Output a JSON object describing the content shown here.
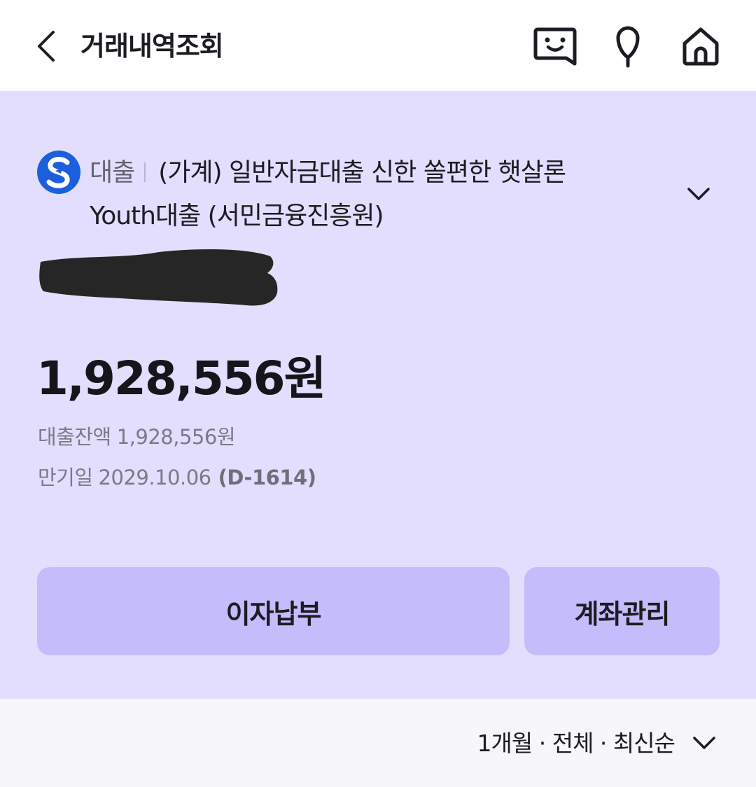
{
  "header": {
    "title": "거래내역조회",
    "back_icon": "chevron-left-icon",
    "chat_icon": "chatbot-icon",
    "pin_icon": "location-pin-icon",
    "home_icon": "home-icon"
  },
  "account": {
    "bank_icon": "shinhan-bank-logo",
    "type": "대출",
    "name_line1": "(가계) 일반자금대출 신한 쏠편한 햇살론",
    "name_line2": "Youth대출 (서민금융진흥원)",
    "expand_icon": "chevron-down-icon",
    "balance_amount": "1,928,556원",
    "loan_balance_label": "대출잔액",
    "loan_balance_value": "1,928,556원",
    "maturity_label": "만기일",
    "maturity_date": "2029.10.06",
    "d_day": "(D-1614)"
  },
  "actions": {
    "pay_interest": "이자납부",
    "manage_account": "계좌관리"
  },
  "filter": {
    "text": "1개월 · 전체 · 최신순",
    "chevron_icon": "chevron-down-icon"
  },
  "colors": {
    "panel_bg": "#e3defd",
    "button_bg": "#c5bcfb",
    "filter_bg": "#f7f7f9",
    "bank_blue": "#1c5fdc"
  }
}
